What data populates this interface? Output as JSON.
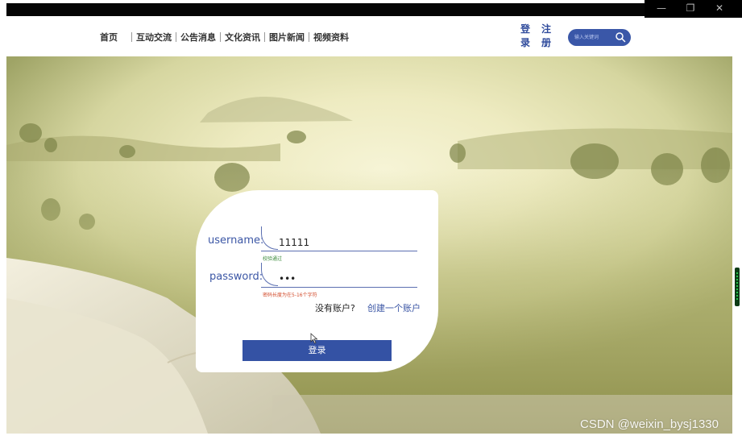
{
  "window": {
    "minimize_glyph": "—",
    "restore_glyph": "❐",
    "close_glyph": "✕"
  },
  "nav": {
    "home": "首页",
    "links": [
      "互动交流",
      "公告消息",
      "文化资讯",
      "图片新闻",
      "视频资料"
    ]
  },
  "auth": {
    "login_top": "登",
    "login_bottom": "录",
    "register_top": "注",
    "register_bottom": "册"
  },
  "search": {
    "placeholder": "输入关键词",
    "icon": "search-icon"
  },
  "form": {
    "username_label": "username:",
    "username_value": "11111",
    "username_hint": "校验通过",
    "password_label": "password:",
    "password_value": "•••",
    "password_hint": "密码长度为在5-16个字符",
    "no_account": "没有账户?",
    "create_account": "创建一个账户",
    "submit": "登录"
  },
  "watermark": "CSDN @weixin_bysj1330",
  "colors": {
    "accent": "#3452a4",
    "ok": "#3a8a3a",
    "error": "#d24a2a"
  }
}
